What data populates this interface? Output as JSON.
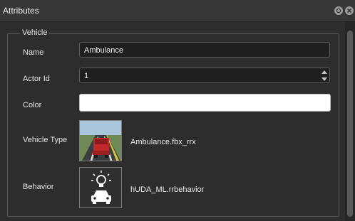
{
  "window": {
    "title": "Attributes"
  },
  "group": {
    "title": "Vehicle"
  },
  "fields": {
    "name": {
      "label": "Name",
      "value": "Ambulance"
    },
    "actor_id": {
      "label": "Actor Id",
      "value": "1"
    },
    "color": {
      "label": "Color",
      "value": "#ffffff"
    },
    "vehicle_type": {
      "label": "Vehicle Type",
      "file": "Ambulance.fbx_rrx"
    },
    "behavior": {
      "label": "Behavior",
      "file": "hUDA_ML.rrbehavior"
    }
  },
  "icons": {
    "restore": "restore-icon",
    "close": "close-icon",
    "behavior": "car-with-lightbulb-icon"
  }
}
